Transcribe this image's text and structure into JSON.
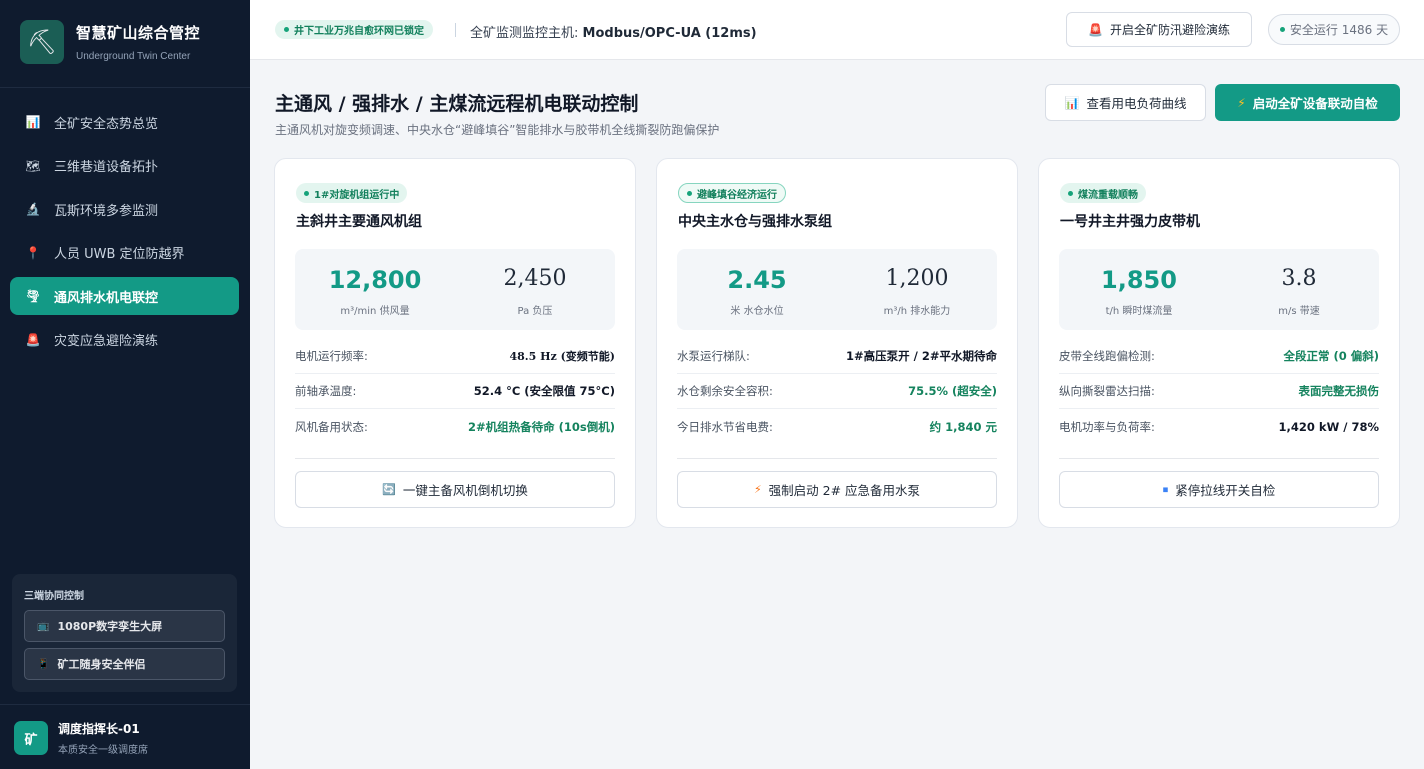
{
  "sidebar": {
    "brand": {
      "title": "智慧矿山综合管控",
      "subtitle": "Underground Twin Center",
      "logo_icon": "⛏"
    },
    "nav": [
      {
        "icon": "📊",
        "label": "全矿安全态势总览",
        "active": false
      },
      {
        "icon": "🗺",
        "label": "三维巷道设备拓扑",
        "active": false
      },
      {
        "icon": "🔬",
        "label": "瓦斯环境多参监测",
        "active": false
      },
      {
        "icon": "📍",
        "label": "人员 UWB 定位防越界",
        "active": false
      },
      {
        "icon": "🌪",
        "label": "通风排水机电联控",
        "active": true
      },
      {
        "icon": "🚨",
        "label": "灾变应急避险演练",
        "active": false
      }
    ],
    "sync": {
      "title": "三端协同控制",
      "buttons": [
        {
          "icon": "📺",
          "label": "1080P数字孪生大屏"
        },
        {
          "icon": "📱",
          "label": "矿工随身安全伴侣"
        }
      ]
    },
    "user": {
      "avatar": "矿",
      "name": "调度指挥长-01",
      "role": "本质安全一级调度席"
    }
  },
  "topbar": {
    "network_badge": "井下工业万兆自愈环网已锁定",
    "host_label": "全矿监测监控主机:",
    "host_value": "Modbus/OPC-UA (12ms)",
    "drill_button": "开启全矿防汛避险演练",
    "drill_icon": "🚨",
    "status": "安全运行 1486 天"
  },
  "page": {
    "title": "主通风 / 强排水 / 主煤流远程机电联动控制",
    "subtitle": "主通风机对旋变频调速、中央水仓“避峰填谷”智能排水与胶带机全线撕裂防跑偏保护",
    "load_button": "查看用电负荷曲线",
    "load_icon": "📊",
    "selftest_button": "启动全矿设备联动自检",
    "selftest_icon": "⚡"
  },
  "cards": [
    {
      "badge": "1#对旋机组运行中",
      "title": "主斜井主要通风机组",
      "metric1": {
        "value": "12,800",
        "label": "m³/min 供风量"
      },
      "metric2": {
        "value": "2,450",
        "label": "Pa 负压"
      },
      "rows": [
        {
          "label": "电机运行频率:",
          "value": "48.5 Hz (变频节能)"
        },
        {
          "label": "前轴承温度:",
          "value": "52.4 °C (安全限值 75°C)"
        },
        {
          "label": "风机备用状态:",
          "value": "2#机组热备待命 (10s倒机)"
        }
      ],
      "action": "一键主备风机倒机切换",
      "action_icon": "🔄"
    },
    {
      "badge": "避峰填谷经济运行",
      "title": "中央主水仓与强排水泵组",
      "metric1": {
        "value": "2.45",
        "label": "米 水仓水位"
      },
      "metric2": {
        "value": "1,200",
        "label": "m³/h 排水能力"
      },
      "rows": [
        {
          "label": "水泵运行梯队:",
          "value": "1#高压泵开 / 2#平水期待命"
        },
        {
          "label": "水仓剩余安全容积:",
          "value": "75.5% (超安全)"
        },
        {
          "label": "今日排水节省电费:",
          "value": "约 1,840 元"
        }
      ],
      "action": "强制启动 2# 应急备用水泵",
      "action_icon": "⚡"
    },
    {
      "badge": "煤流重载顺畅",
      "title": "一号井主井强力皮带机",
      "metric1": {
        "value": "1,850",
        "label": "t/h 瞬时煤流量"
      },
      "metric2": {
        "value": "3.8",
        "label": "m/s 带速"
      },
      "rows": [
        {
          "label": "皮带全线跑偏检测:",
          "value": "全段正常 (0 偏斜)"
        },
        {
          "label": "纵向撕裂雷达扫描:",
          "value": "表面完整无损伤"
        },
        {
          "label": "电机功率与负荷率:",
          "value": "1,420 kW / 78%"
        }
      ],
      "action": "紧停拉线开关自检",
      "action_icon": "⏹"
    }
  ]
}
